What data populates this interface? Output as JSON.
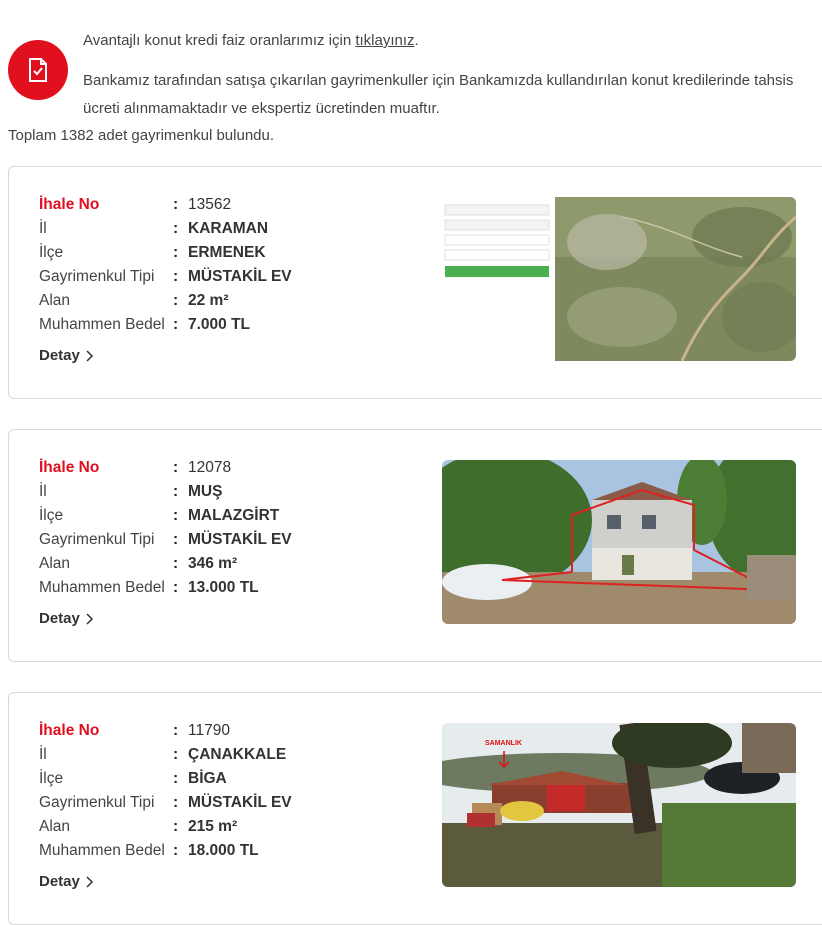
{
  "notice": {
    "line1_prefix": "Avantajlı konut kredi faiz oranlarımız için ",
    "line1_link": "tıklayınız",
    "line1_suffix": ".",
    "line2": "Bankamız tarafından satışa çıkarılan gayrimenkuller için Bankamızda kullandırılan konut kredilerinde tahsis ücreti alınmamaktadır ve ekspertiz ücretinden muaftır.",
    "icon": "document-check-icon",
    "accent_color": "#e0101f"
  },
  "total_text": "Toplam 1382 adet gayrimenkul bulundu.",
  "labels": {
    "ihale_no": "İhale No",
    "il": "İl",
    "ilce": "İlçe",
    "tip": "Gayrimenkul Tipi",
    "alan": "Alan",
    "bedel": "Muhammen Bedel",
    "colon": ":",
    "detail": "Detay",
    "detail_icon": "chevron-right-icon"
  },
  "listings": [
    {
      "ihale_no": "13562",
      "il": "KARAMAN",
      "ilce": "ERMENEK",
      "tip": "MÜSTAKİL EV",
      "alan": "22 m²",
      "bedel": "7.000 TL",
      "photo": "satellite-map-photo"
    },
    {
      "ihale_no": "12078",
      "il": "MUŞ",
      "ilce": "MALAZGİRT",
      "tip": "MÜSTAKİL EV",
      "alan": "346 m²",
      "bedel": "13.000 TL",
      "photo": "house-photo"
    },
    {
      "ihale_no": "11790",
      "il": "ÇANAKKALE",
      "ilce": "BİGA",
      "tip": "MÜSTAKİL EV",
      "alan": "215 m²",
      "bedel": "18.000 TL",
      "photo": "barn-photo",
      "photo_caption": "SAMANLIK"
    }
  ]
}
